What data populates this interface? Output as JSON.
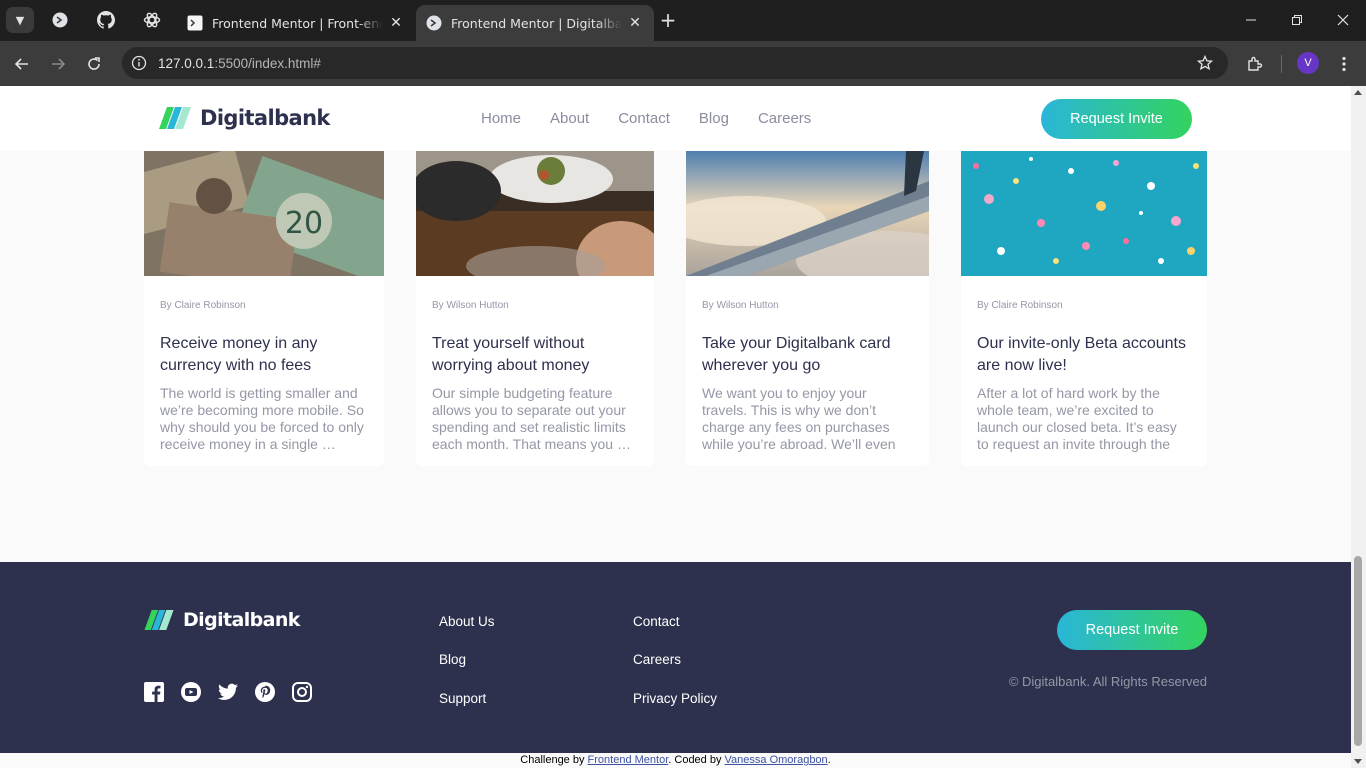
{
  "browser": {
    "tabs": [
      {
        "title": "Frontend Mentor | Front-end coding challenges",
        "active": false
      },
      {
        "title": "Frontend Mentor | Digitalbank landing page",
        "active": true
      }
    ],
    "url_host": "127.0.0.1",
    "url_rest": ":5500/index.html#",
    "profile_initial": "V",
    "icons": [
      "tab-search-icon",
      "pinned-site-icon",
      "github-icon",
      "openai-icon",
      "new-tab-icon",
      "minimize-icon",
      "restore-icon",
      "close-icon",
      "back-icon",
      "forward-icon",
      "reload-icon",
      "site-info-icon",
      "bookmark-star-icon",
      "extensions-icon",
      "menu-kebab-icon"
    ]
  },
  "header": {
    "brand": "Digitalbank",
    "nav": [
      "Home",
      "About",
      "Contact",
      "Blog",
      "Careers"
    ],
    "cta": "Request Invite"
  },
  "articles": [
    {
      "author": "By Claire Robinson",
      "title": "Receive money in any currency with no fees",
      "excerpt": "The world is getting smaller and we’re becoming more mobile. So why should you be forced to only receive money in a single …"
    },
    {
      "author": "By Wilson Hutton",
      "title": "Treat yourself without worrying about money",
      "excerpt": "Our simple budgeting feature allows you to separate out your spending and set realistic limits each month. That means you …"
    },
    {
      "author": "By Wilson Hutton",
      "title": "Take your Digitalbank card wherever you go",
      "excerpt": "We want you to enjoy your travels. This is why we don’t charge any fees on purchases while you’re abroad. We’ll even show you …"
    },
    {
      "author": "By Claire Robinson",
      "title": "Our invite-only Beta accounts are now live!",
      "excerpt": "After a lot of hard work by the whole team, we’re excited to launch our closed beta. It’s easy to request an invite through the sit…"
    }
  ],
  "footer": {
    "brand": "Digitalbank",
    "links_col1": [
      "About Us",
      "Blog",
      "Support"
    ],
    "links_col2": [
      "Contact",
      "Careers",
      "Privacy Policy"
    ],
    "cta": "Request Invite",
    "copyright": "© Digitalbank. All Rights Reserved",
    "socials": [
      "facebook-icon",
      "youtube-icon",
      "twitter-icon",
      "pinterest-icon",
      "instagram-icon"
    ]
  },
  "attribution": {
    "prefix": "Challenge by ",
    "link1": "Frontend Mentor",
    "middle": ". Coded by ",
    "link2": "Vanessa Omoragbon",
    "suffix": "."
  },
  "colors": {
    "dark_blue": "#2d314d",
    "grayish_blue": "#9597a6",
    "lime_green": "#33d35e",
    "bright_cyan": "#2ab6d9",
    "chrome_bg": "#1f1f1f"
  }
}
